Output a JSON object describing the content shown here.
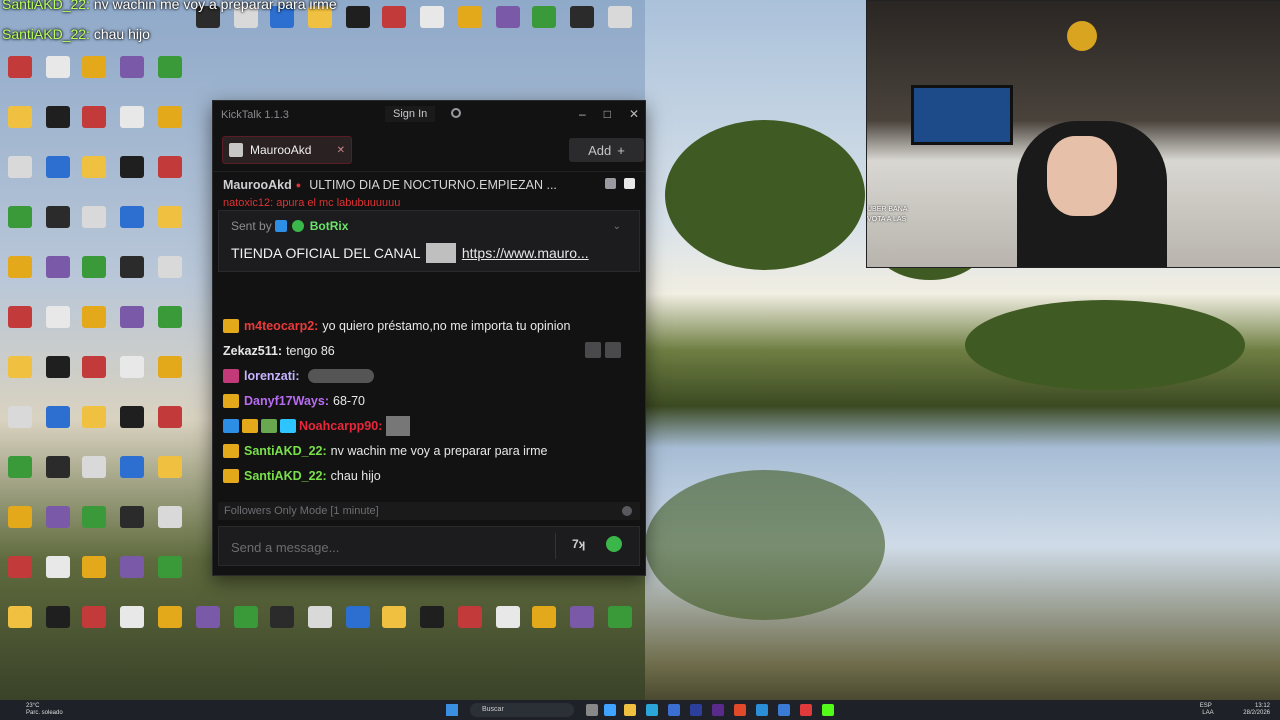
{
  "overlay": {
    "line1_user": "SantiAKD_22:",
    "line1_text": "nv wachin me voy a preparar para irme",
    "line2_user": "SantiAKD_22:",
    "line2_text": "chau hijo"
  },
  "app": {
    "title": "KickTalk 1.1.3",
    "sign_in": "Sign In",
    "window_buttons": [
      "–",
      "□",
      "✕"
    ]
  },
  "tab": {
    "label": "MaurooAkd",
    "close": "✕",
    "add_label": "Add",
    "add_plus": "+"
  },
  "pinned_bar": {
    "user": "MaurooAkd",
    "live_dot": "●",
    "title": "ULTIMO DIA DE NOCTURNO.EMPIEZAN ...",
    "partial_line": "natoxic12: apura el mc labubuuuuuu"
  },
  "pinned_message": {
    "sent_by": "Sent by",
    "sender": "BotRix",
    "text": "TIENDA OFICIAL DEL CANAL",
    "link": "https://www.mauro..."
  },
  "messages": [
    {
      "user": "m4teocarp2:",
      "color": "#ea3a3a",
      "text": "yo quiero préstamo,no me importa tu opinion",
      "badge": "crown"
    },
    {
      "user": "Zekaz511:",
      "color": "#e6e6e6",
      "text": "tengo 86",
      "badge": "none"
    },
    {
      "user": "lorenzati:",
      "color": "#c5b4ff",
      "text": "",
      "badge": "pink",
      "emote": true
    },
    {
      "user": "Danyf17Ways:",
      "color": "#b86cf0",
      "text": "68-70",
      "badge": "crown"
    },
    {
      "user": "Noahcarpp90:",
      "color": "#e8283a",
      "text": "",
      "badge": "multi",
      "mini": true
    },
    {
      "user": "SantiAKD_22:",
      "color": "#79e04a",
      "text": "nv wachin me voy a preparar para irme",
      "badge": "crown"
    },
    {
      "user": "SantiAKD_22:",
      "color": "#79e04a",
      "text": "chau hijo",
      "badge": "crown"
    }
  ],
  "footer": {
    "followers_mode": "Followers Only Mode [1 minute]",
    "input_placeholder": "Send a message...",
    "kick_emote_label": "7ʞ"
  },
  "webcam": {
    "overlay_text_1": "UBER BANA",
    "overlay_text_2": "VOTA A LAS"
  },
  "taskbar": {
    "weather_temp": "23°C",
    "weather_desc": "Parc. soleado",
    "search": "Buscar",
    "lang": "ESP",
    "lang2": "LAA",
    "time": "13:12",
    "date": "28/2/2026"
  },
  "colors": {
    "accent_green": "#53fc18",
    "tab_border": "#5a1d25",
    "crown": "#e3a91a"
  }
}
